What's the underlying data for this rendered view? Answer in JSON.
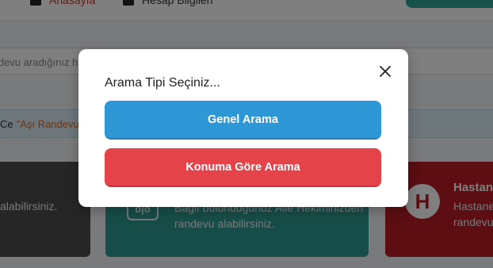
{
  "topnav": {
    "home_label": "Anasayfa",
    "account_label": "Hesap Bilgileri",
    "home_icon": "home-icon",
    "account_icon": "user-icon"
  },
  "search": {
    "placeholder": "Randevu aradığınız hastane, klinik veya doktor"
  },
  "notice": {
    "prefix": "Ce",
    "link": "\"Aşı Randevusu\""
  },
  "cards": {
    "gray_text": "alabilirsiniz.",
    "teal_text": "Bağlı bulunduğunuz Aile Hekiminizden randevu alabilirsiniz.",
    "teal_icon": "family-icon",
    "red_title": "Hastane",
    "red_text": "Hastane randevu",
    "red_icon": "hospital-icon"
  },
  "modal": {
    "title": "Arama Tipi Seçiniz...",
    "close_icon": "close-icon",
    "general_search_label": "Genel Arama",
    "location_search_label": "Konuma Göre Arama"
  },
  "colors": {
    "primary_blue": "#2e97d5",
    "danger_red": "#e44349",
    "teal": "#2e9a90",
    "hospital_red": "#b81d24"
  }
}
